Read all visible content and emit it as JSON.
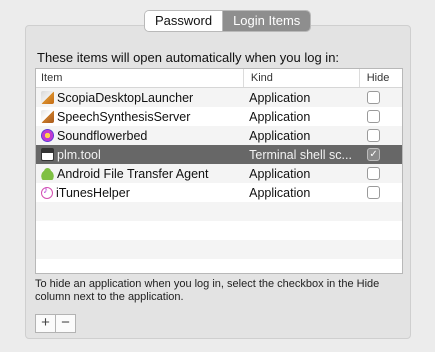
{
  "tabs": [
    {
      "label": "Password",
      "active": false
    },
    {
      "label": "Login Items",
      "active": true
    }
  ],
  "heading": "These items will open automatically when you log in:",
  "table": {
    "columns": [
      "Item",
      "Kind",
      "Hide"
    ],
    "rows": [
      {
        "item": "ScopiaDesktopLauncher",
        "kind": "Application",
        "hide": false,
        "icon": "scopia-app-icon",
        "selected": false
      },
      {
        "item": "SpeechSynthesisServer",
        "kind": "Application",
        "hide": false,
        "icon": "speech-synthesis-app-icon",
        "selected": false
      },
      {
        "item": "Soundflowerbed",
        "kind": "Application",
        "hide": false,
        "icon": "soundflowerbed-app-icon",
        "selected": false
      },
      {
        "item": "plm.tool",
        "kind": "Terminal shell sc...",
        "hide": true,
        "icon": "terminal-script-icon",
        "selected": true
      },
      {
        "item": "Android File Transfer Agent",
        "kind": "Application",
        "hide": false,
        "icon": "android-app-icon",
        "selected": false
      },
      {
        "item": "iTunesHelper",
        "kind": "Application",
        "hide": false,
        "icon": "itunes-app-icon",
        "selected": false
      }
    ]
  },
  "help_text": "To hide an application when you log in, select the checkbox in the Hide column next to the application.",
  "buttons": {
    "add": "+",
    "remove": "−"
  },
  "colors": {
    "selected_row": "#676767",
    "tab_active": "#8e8e8e"
  }
}
